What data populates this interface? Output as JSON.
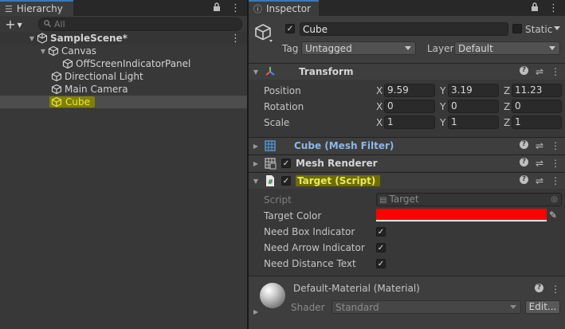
{
  "hierarchy": {
    "tab_label": "Hierarchy",
    "search_placeholder": "All",
    "items": [
      {
        "label": "SampleScene*"
      },
      {
        "label": "Canvas"
      },
      {
        "label": "OffScreenIndicatorPanel"
      },
      {
        "label": "Directional Light"
      },
      {
        "label": "Main Camera"
      },
      {
        "label": "Cube"
      }
    ]
  },
  "inspector": {
    "tab_label": "Inspector",
    "object": {
      "name": "Cube",
      "static_label": "Static",
      "tag_label": "Tag",
      "tag_value": "Untagged",
      "layer_label": "Layer",
      "layer_value": "Default"
    },
    "transform": {
      "title": "Transform",
      "position": {
        "label": "Position",
        "x": "9.59",
        "y": "3.19",
        "z": "11.23"
      },
      "rotation": {
        "label": "Rotation",
        "x": "0",
        "y": "0",
        "z": "0"
      },
      "scale": {
        "label": "Scale",
        "x": "1",
        "y": "1",
        "z": "1"
      },
      "axis_x": "X",
      "axis_y": "Y",
      "axis_z": "Z"
    },
    "mesh_filter": {
      "title": "Cube (Mesh Filter)"
    },
    "mesh_renderer": {
      "title": "Mesh Renderer"
    },
    "target_script": {
      "title": "Target (Script)",
      "script_label": "Script",
      "script_value": "Target",
      "target_color_label": "Target Color",
      "target_color_value": "#ff0000",
      "need_box_label": "Need Box Indicator",
      "need_arrow_label": "Need Arrow Indicator",
      "need_distance_label": "Need Distance Text"
    },
    "material": {
      "title": "Default-Material (Material)",
      "shader_label": "Shader",
      "shader_value": "Standard",
      "edit_label": "Edit..."
    }
  },
  "colors": {
    "accent_tab": "#3a79bb",
    "highlight": "#808000",
    "link": "#8cb7e6"
  }
}
